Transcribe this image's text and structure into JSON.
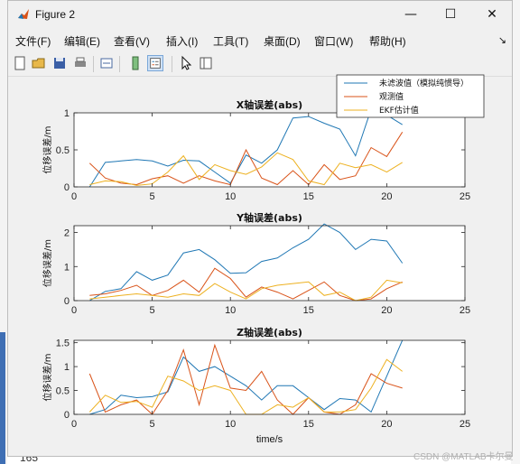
{
  "window": {
    "title": "Figure 2"
  },
  "menu": [
    "文件(F)",
    "编辑(E)",
    "查看(V)",
    "插入(I)",
    "工具(T)",
    "桌面(D)",
    "窗口(W)",
    "帮助(H)"
  ],
  "toolbar": [
    "new-figure-icon",
    "open-icon",
    "save-icon",
    "print-icon",
    "link-icon",
    "colorbar-icon",
    "legend-icon",
    "pointer-icon",
    "property-editor-icon"
  ],
  "background": {
    "bottom_number": "165",
    "watermark": "CSDN @MATLAB卡尔曼"
  },
  "colors": {
    "series1": "#1f77b4",
    "series2": "#d95319",
    "series3": "#edb120"
  },
  "chart_data": [
    {
      "type": "line",
      "title": "X轴误差(abs)",
      "xlabel": "",
      "ylabel": "位移误差/m",
      "xlim": [
        0,
        25
      ],
      "ylim": [
        0,
        1
      ],
      "xticks": [
        0,
        5,
        10,
        15,
        20,
        25
      ],
      "yticks": [
        0,
        0.5,
        1
      ],
      "ytick_labels": [
        "0",
        "0.5",
        "1"
      ],
      "x": [
        1,
        2,
        3,
        4,
        5,
        6,
        7,
        8,
        9,
        10,
        11,
        12,
        13,
        14,
        15,
        16,
        17,
        18,
        19,
        20,
        21
      ],
      "series": [
        {
          "name": "未滤波值（模拟纯惯导）",
          "values": [
            0,
            0.33,
            0.35,
            0.37,
            0.35,
            0.28,
            0.36,
            0.35,
            0.2,
            0.05,
            0.43,
            0.32,
            0.5,
            0.93,
            0.95,
            0.86,
            0.78,
            0.42,
            1.05,
            0.97,
            0.84
          ]
        },
        {
          "name": "观测值",
          "values": [
            0.32,
            0.12,
            0.05,
            0.03,
            0.11,
            0.15,
            0.05,
            0.15,
            0.08,
            0.03,
            0.5,
            0.12,
            0.03,
            0.22,
            0.03,
            0.3,
            0.1,
            0.15,
            0.53,
            0.41,
            0.74
          ]
        },
        {
          "name": "EKF估计值",
          "values": [
            0.03,
            0.08,
            0.07,
            0.02,
            0.04,
            0.2,
            0.42,
            0.1,
            0.3,
            0.22,
            0.17,
            0.27,
            0.46,
            0.37,
            0.08,
            0.03,
            0.32,
            0.26,
            0.3,
            0.2,
            0.33
          ]
        }
      ],
      "legend": {
        "location": "top-right",
        "entries": [
          "未滤波值（模拟纯惯导）",
          "观测值",
          "EKF估计值"
        ]
      }
    },
    {
      "type": "line",
      "title": "Y轴误差(abs)",
      "xlabel": "",
      "ylabel": "位移误差/m",
      "xlim": [
        0,
        25
      ],
      "ylim": [
        0,
        2.2
      ],
      "xticks": [
        0,
        5,
        10,
        15,
        20,
        25
      ],
      "yticks": [
        0,
        1,
        2
      ],
      "ytick_labels": [
        "0",
        "1",
        "2"
      ],
      "x": [
        1,
        2,
        3,
        4,
        5,
        6,
        7,
        8,
        9,
        10,
        11,
        12,
        13,
        14,
        15,
        16,
        17,
        18,
        19,
        20,
        21
      ],
      "series": [
        {
          "name": "未滤波值（模拟纯惯导）",
          "values": [
            0,
            0.27,
            0.35,
            0.85,
            0.6,
            0.75,
            1.4,
            1.5,
            1.2,
            0.8,
            0.82,
            1.15,
            1.25,
            1.55,
            1.8,
            2.25,
            2.0,
            1.5,
            1.8,
            1.75,
            1.1
          ]
        },
        {
          "name": "观测值",
          "values": [
            0.15,
            0.2,
            0.3,
            0.45,
            0.15,
            0.3,
            0.6,
            0.25,
            0.95,
            0.65,
            0.1,
            0.4,
            0.25,
            0.05,
            0.3,
            0.55,
            0.15,
            0,
            0.05,
            0.35,
            0.55
          ]
        },
        {
          "name": "EKF估计值",
          "values": [
            0.05,
            0.1,
            0.15,
            0.2,
            0.15,
            0.1,
            0.2,
            0.15,
            0.5,
            0.25,
            0.05,
            0.35,
            0.45,
            0.5,
            0.55,
            0.15,
            0.25,
            0,
            0.1,
            0.6,
            0.52
          ]
        }
      ]
    },
    {
      "type": "line",
      "title": "Z轴误差(abs)",
      "xlabel": "time/s",
      "ylabel": "位移误差/m",
      "xlim": [
        0,
        25
      ],
      "ylim": [
        0,
        1.55
      ],
      "xticks": [
        0,
        5,
        10,
        15,
        20,
        25
      ],
      "yticks": [
        0,
        0.5,
        1,
        1.5
      ],
      "ytick_labels": [
        "0",
        "0.5",
        "1",
        "1.5"
      ],
      "x": [
        1,
        2,
        3,
        4,
        5,
        6,
        7,
        8,
        9,
        10,
        11,
        12,
        13,
        14,
        15,
        16,
        17,
        18,
        19,
        20,
        21
      ],
      "series": [
        {
          "name": "未滤波值（模拟纯惯导）",
          "values": [
            0,
            0.1,
            0.4,
            0.35,
            0.37,
            0.47,
            1.2,
            0.9,
            1.0,
            0.8,
            0.6,
            0.3,
            0.6,
            0.6,
            0.35,
            0.1,
            0.33,
            0.3,
            0.05,
            0.8,
            1.55
          ]
        },
        {
          "name": "观测值",
          "values": [
            0.85,
            0.05,
            0.2,
            0.3,
            0.0,
            0.5,
            1.35,
            0.2,
            1.45,
            0.55,
            0.5,
            0.9,
            0.3,
            0.0,
            0.35,
            0.05,
            0.0,
            0.2,
            0.85,
            0.65,
            0.55
          ]
        },
        {
          "name": "EKF估计值",
          "values": [
            0.05,
            0.4,
            0.25,
            0.27,
            0.15,
            0.8,
            0.7,
            0.5,
            0.6,
            0.5,
            0.0,
            0.0,
            0.2,
            0.15,
            0.35,
            0.05,
            0.05,
            0.1,
            0.55,
            1.15,
            0.9
          ]
        }
      ]
    }
  ]
}
